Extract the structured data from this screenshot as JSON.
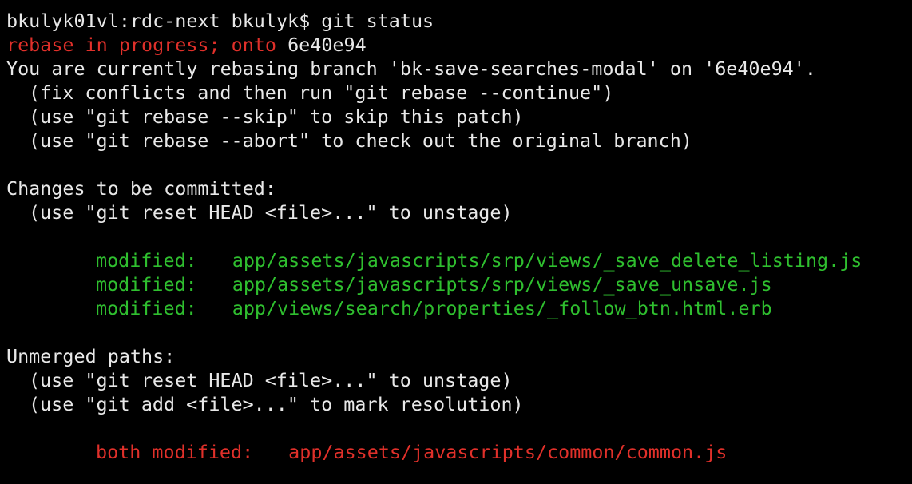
{
  "terminal": {
    "prompt_line": "bkulyk01vl:rdc-next bkulyk$ git status",
    "rebase_status": {
      "label": "rebase in progress; onto",
      "commit": "6e40e94"
    },
    "rebasing_info": "You are currently rebasing branch 'bk-save-searches-modal' on '6e40e94'.",
    "hints": [
      "(fix conflicts and then run \"git rebase --continue\")",
      "(use \"git rebase --skip\" to skip this patch)",
      "(use \"git rebase --abort\" to check out the original branch)"
    ],
    "staged": {
      "header": "Changes to be committed:",
      "hint": "(use \"git reset HEAD <file>...\" to unstage)",
      "files": [
        {
          "status": "modified:",
          "path": "app/assets/javascripts/srp/views/_save_delete_listing.js"
        },
        {
          "status": "modified:",
          "path": "app/assets/javascripts/srp/views/_save_unsave.js"
        },
        {
          "status": "modified:",
          "path": "app/views/search/properties/_follow_btn.html.erb"
        }
      ]
    },
    "unmerged": {
      "header": "Unmerged paths:",
      "hints": [
        "(use \"git reset HEAD <file>...\" to unstage)",
        "(use \"git add <file>...\" to mark resolution)"
      ],
      "files": [
        {
          "status": "both modified:",
          "path": "app/assets/javascripts/common/common.js"
        }
      ]
    },
    "colors": {
      "background": "#000000",
      "text": "#e8e8e8",
      "warning": "#e0302a",
      "staged": "#2fbf2f"
    }
  }
}
